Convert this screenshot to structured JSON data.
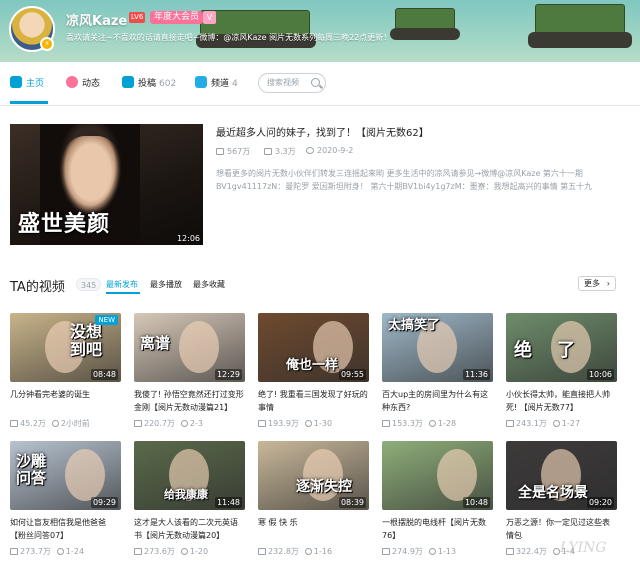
{
  "header": {
    "username": "凉风Kaze",
    "level": "LV6",
    "vip_label": "年度大会员",
    "vip_icon": "V",
    "sign": "喜欢请关注~不喜欢的话请直接走吧~微博：@凉风Kaze 阅片无数系列每周三晚22点更新！"
  },
  "nav": {
    "items": [
      {
        "label": "主页",
        "count": "",
        "icon": "home-icon"
      },
      {
        "label": "动态",
        "count": "",
        "icon": "dynamic-icon"
      },
      {
        "label": "投稿",
        "count": "602",
        "icon": "upload-icon"
      },
      {
        "label": "频道",
        "count": "4",
        "icon": "channel-icon"
      }
    ],
    "search_placeholder": "搜索视频"
  },
  "featured": {
    "caption": "盛世美颜",
    "duration": "12:06",
    "title": "最近超多人问的妹子，找到了！【阅片无数62】",
    "plays": "567万",
    "comments": "3.3万",
    "date": "2020-9-2",
    "desc_line1": "想看更多的阅片无数小伙伴们转发三连摇起来哟 更多生活中的凉风请参见→微博@凉风Kaze 第六十一期",
    "desc_line2": "BV1gv41117zN：曼陀罗 爱因斯坦附身！ 第六十期BV1bi4y1g7zM：噩寮：我想起高兴的事情 第五十九"
  },
  "videos_section": {
    "title": "TA的视频",
    "count": "345",
    "sort_options": [
      "最新发布",
      "最多播放",
      "最多收藏"
    ],
    "more_label": "更多"
  },
  "videos": [
    {
      "caption": "没想\n到吧",
      "duration": "08:48",
      "is_new": true,
      "new_label": "NEW",
      "title": "几分钟看完老婆的诞生",
      "plays": "45.2万",
      "time": "2小时前",
      "bg": "#c9b48a"
    },
    {
      "caption": "离谱",
      "duration": "12:29",
      "is_new": false,
      "title": "我傻了! 孙悟空竟然还打过变形金刚【阅片无数动漫篇21】",
      "plays": "220.7万",
      "time": "2-3",
      "bg": "#d7c8b8"
    },
    {
      "caption": "俺也一样",
      "duration": "09:55",
      "is_new": false,
      "title": "绝了! 我重看三国发现了好玩的事情",
      "plays": "193.9万",
      "time": "1-30",
      "bg": "#6f4a2f"
    },
    {
      "caption": "太搞笑了",
      "duration": "11:36",
      "is_new": false,
      "title": "百大up主的房间里为什么有这种东西?",
      "plays": "153.3万",
      "time": "1-28",
      "bg": "#9fb8c8"
    },
    {
      "caption": "绝    了",
      "duration": "10:06",
      "is_new": false,
      "title": "小伙长得太帅，能直接把人帅死! 【阅片无数77】",
      "plays": "243.1万",
      "time": "1-27",
      "bg": "#6e8d6b"
    },
    {
      "caption": "沙雕\n问答",
      "duration": "09:29",
      "is_new": false,
      "title": "如何让盲友相信我是他爸爸【粉丝问答07】",
      "plays": "273.7万",
      "time": "1-24",
      "bg": "#b7c3d0"
    },
    {
      "caption": "给我康康",
      "duration": "11:48",
      "is_new": false,
      "title": "这才是大人该看的二次元英语书【阅片无数动漫篇20】",
      "plays": "273.6万",
      "time": "1-20",
      "bg": "#5a6a4a"
    },
    {
      "caption": "逐渐失控",
      "duration": "08:39",
      "is_new": false,
      "title": "寒 假 快 乐",
      "plays": "232.8万",
      "time": "1-16",
      "bg": "#c9b89a"
    },
    {
      "caption": "",
      "duration": "10:48",
      "is_new": false,
      "title": "一根摆脱的电线杆【阅片无数76】",
      "plays": "274.9万",
      "time": "1-13",
      "bg": "#8fae7a"
    },
    {
      "caption": "全是名场景",
      "duration": "09:20",
      "is_new": false,
      "title": "万恶之源！你一定见过这些表情包",
      "plays": "322.4万",
      "time": "1-4",
      "bg": "#3d3a3a"
    }
  ],
  "watermark": "LYING",
  "colors": {
    "accent": "#00a1d6",
    "pink": "#fb7299",
    "muted": "#99a2aa"
  }
}
